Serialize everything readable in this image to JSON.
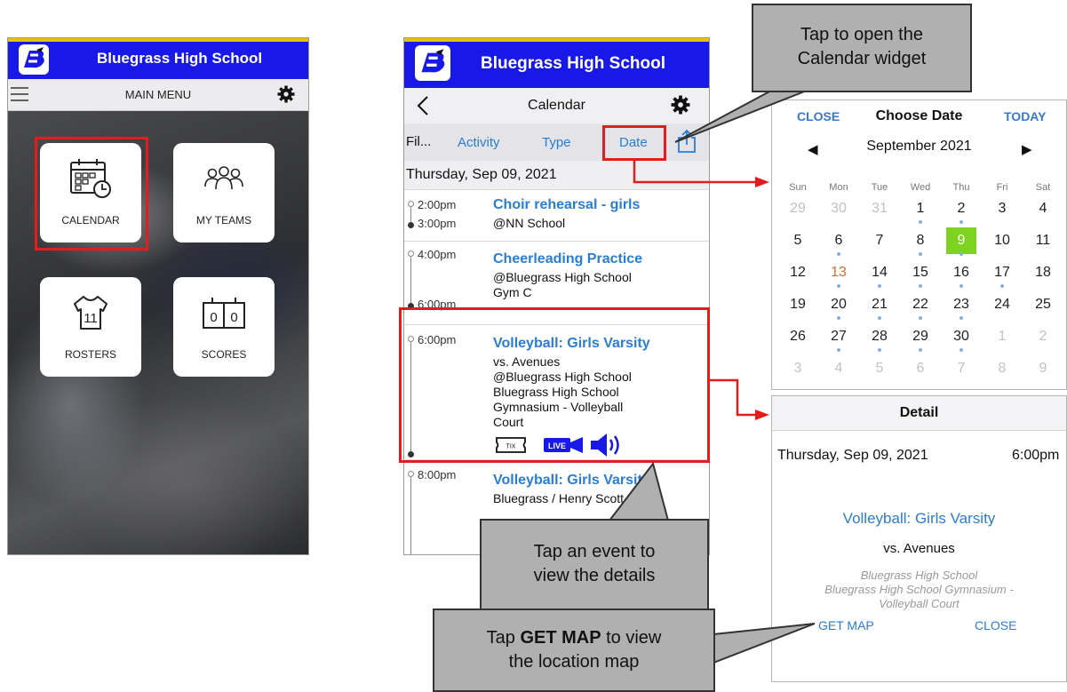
{
  "phone1": {
    "school_name": "Bluegrass High School",
    "menu_title": "MAIN MENU",
    "tiles": [
      {
        "label": "CALENDAR",
        "icon": "calendar-icon"
      },
      {
        "label": "MY TEAMS",
        "icon": "teams-icon"
      },
      {
        "label": "ROSTERS",
        "icon": "jersey-icon"
      },
      {
        "label": "SCORES",
        "icon": "scoreboard-icon"
      }
    ],
    "jersey_number": "11",
    "score_digits": [
      "0",
      "0"
    ]
  },
  "phone2": {
    "school_name": "Bluegrass High School",
    "nav_title": "Calendar",
    "filters": {
      "label": "Fil...",
      "activity": "Activity",
      "type": "Type",
      "date": "Date"
    },
    "day_header": "Thursday, Sep 09, 2021",
    "events": [
      {
        "start": "2:00pm",
        "end": "3:00pm",
        "title": "Choir rehearsal - girls",
        "lines": [
          "@NN School"
        ]
      },
      {
        "start": "4:00pm",
        "end": "6:00pm",
        "title": "Cheerleading Practice",
        "lines": [
          "@Bluegrass High School",
          "Gym C"
        ]
      },
      {
        "start": "6:00pm",
        "end": "",
        "title": "Volleyball: Girls Varsity",
        "lines": [
          "vs. Avenues",
          "@Bluegrass High School",
          "Bluegrass High School",
          "Gymnasium - Volleyball",
          "Court"
        ],
        "badges": [
          "TIX",
          "LIVE"
        ]
      },
      {
        "start": "8:00pm",
        "end": "",
        "title": "Volleyball: Girls Varsity",
        "lines": [
          "Bluegrass / Henry Scott Sc."
        ]
      }
    ]
  },
  "calendar_widget": {
    "close": "CLOSE",
    "title": "Choose Date",
    "today": "TODAY",
    "month": "September 2021",
    "weekdays": [
      "Sun",
      "Mon",
      "Tue",
      "Wed",
      "Thu",
      "Fri",
      "Sat"
    ],
    "weeks": [
      [
        "29",
        "30",
        "31",
        "1",
        "2",
        "3",
        "4"
      ],
      [
        "5",
        "6",
        "7",
        "8",
        "9",
        "10",
        "11"
      ],
      [
        "12",
        "13",
        "14",
        "15",
        "16",
        "17",
        "18"
      ],
      [
        "19",
        "20",
        "21",
        "22",
        "23",
        "24",
        "25"
      ],
      [
        "26",
        "27",
        "28",
        "29",
        "30",
        "1",
        "2"
      ],
      [
        "3",
        "4",
        "5",
        "6",
        "7",
        "8",
        "9"
      ]
    ],
    "selected_day": "9",
    "today_day": "13",
    "selected_color": "#7ed321",
    "today_color": "#e06a2c"
  },
  "detail": {
    "header": "Detail",
    "date": "Thursday, Sep 09, 2021",
    "time": "6:00pm",
    "title": "Volleyball: Girls Varsity",
    "opponent": "vs. Avenues",
    "location_lines": [
      "Bluegrass High School",
      "Bluegrass High School Gymnasium -",
      "Volleyball Court"
    ],
    "get_map": "GET MAP",
    "close": "CLOSE"
  },
  "callouts": {
    "calendar_widget": [
      "Tap to open the",
      "Calendar widget"
    ],
    "event": [
      "Tap an event to",
      "view the details"
    ],
    "get_map": {
      "pre": "Tap ",
      "bold": "GET MAP",
      "post": " to view",
      "line2": "the location map"
    }
  },
  "colors": {
    "header_blue": "#1818e8",
    "header_gold": "#e8c000",
    "link_blue": "#2a7dd4",
    "highlight_red": "#e51c1c"
  }
}
